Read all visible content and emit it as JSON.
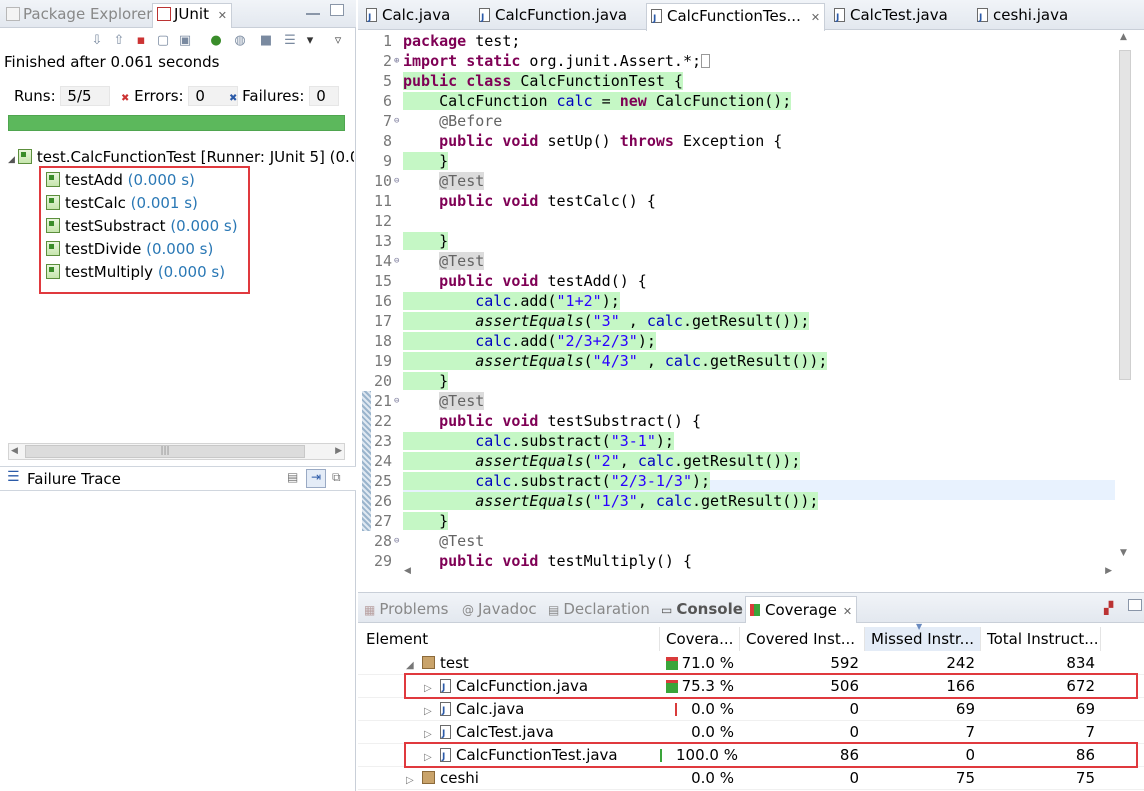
{
  "left_view": {
    "tabs": [
      "Package Explorer",
      "JUnit"
    ],
    "finished_text": "Finished after 0.061 seconds",
    "runs_label": "Runs:",
    "runs_value": "5/5",
    "errors_label": "Errors:",
    "errors_value": "0",
    "failures_label": "Failures:",
    "failures_value": "0",
    "progress_fraction": 1.0,
    "progress_color": "#5cb85c",
    "suite": {
      "label": "test.CalcFunctionTest [Runner: JUnit 5] (0.0"
    },
    "tests": [
      {
        "name": "testAdd",
        "time": "(0.000 s)"
      },
      {
        "name": "testCalc",
        "time": "(0.001 s)"
      },
      {
        "name": "testSubstract",
        "time": "(0.000 s)"
      },
      {
        "name": "testDivide",
        "time": "(0.000 s)"
      },
      {
        "name": "testMultiply",
        "time": "(0.000 s)"
      }
    ],
    "failure_trace_label": "Failure Trace"
  },
  "editor": {
    "tabs": [
      "Calc.java",
      "CalcFunction.java",
      "CalcFunctionTes...",
      "CalcTest.java",
      "ceshi.java"
    ],
    "active_tab": "CalcFunctionTes...",
    "coverage_color": "#c5f7c5"
  },
  "bottom": {
    "tabs": [
      "Problems",
      "Javadoc",
      "Declaration",
      "Console",
      "Coverage"
    ],
    "headers": [
      "Element",
      "Covera...",
      "Covered Inst...",
      "Missed Instr...",
      "Total Instruct..."
    ],
    "rows": [
      {
        "element": "test",
        "coverage": "71.0 %",
        "covered": "592",
        "missed": "242",
        "total": "834"
      },
      {
        "element": "CalcFunction.java",
        "coverage": "75.3 %",
        "covered": "506",
        "missed": "166",
        "total": "672"
      },
      {
        "element": "Calc.java",
        "coverage": "0.0 %",
        "covered": "0",
        "missed": "69",
        "total": "69"
      },
      {
        "element": "CalcTest.java",
        "coverage": "0.0 %",
        "covered": "0",
        "missed": "7",
        "total": "7"
      },
      {
        "element": "CalcFunctionTest.java",
        "coverage": "100.0 %",
        "covered": "86",
        "missed": "0",
        "total": "86"
      },
      {
        "element": "ceshi",
        "coverage": "0.0 %",
        "covered": "0",
        "missed": "75",
        "total": "75"
      }
    ],
    "highlight_color": "#e0393e"
  }
}
